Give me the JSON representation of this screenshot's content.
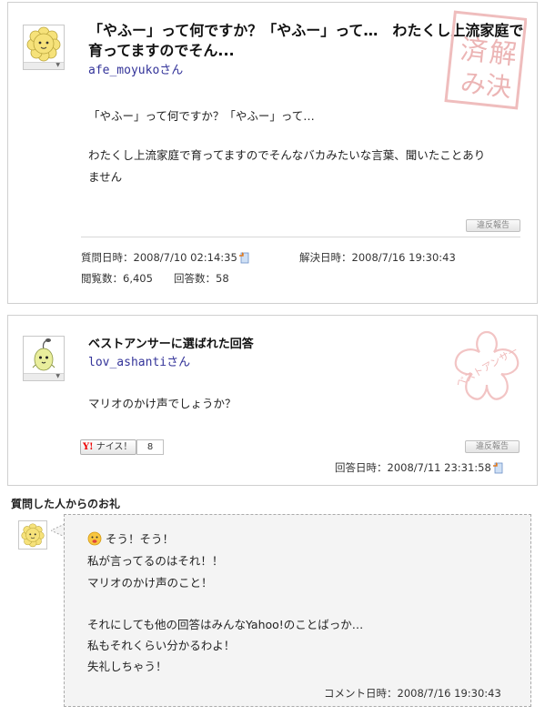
{
  "question": {
    "title": "「やふー」って何ですか？「やふー」って…　わたくし上流家庭で育ってますのでそん...",
    "user_id": "afe_moyuko",
    "honorific": "さん",
    "body_line1": "「やふー」って何ですか？「やふー」って…",
    "body_line2": "わたくし上流家庭で育ってますのでそんなバカみたいな言葉、聞いたことあり",
    "body_line3": "ません",
    "report_label": "違反報告",
    "asked_label": "質問日時：",
    "asked_value": "2008/7/10 02:14:35",
    "resolved_label": "解決日時：",
    "resolved_value": "2008/7/16 19:30:43",
    "views_label": "閲覧数：",
    "views_value": "6,405",
    "answers_label": "回答数：",
    "answers_value": "58",
    "stamp_text_1": "済",
    "stamp_text_2": "解",
    "stamp_text_3": "み決"
  },
  "best_answer": {
    "heading": "ベストアンサーに選ばれた回答",
    "user_id": "lov_ashanti",
    "honorific": "さん",
    "body": "マリオのかけ声でしょうか？",
    "nice_logo": "Y!",
    "nice_label": "ナイス！",
    "nice_count": "8",
    "report_label": "違反報告",
    "answered_label": "回答日時：",
    "answered_value": "2008/7/11 23:31:58",
    "stamp_text": "ベストアンサー"
  },
  "thanks": {
    "heading": "質問した人からのお礼",
    "line1": "そう！そう！",
    "line2": "私が言ってるのはそれ！！",
    "line3": "マリオのかけ声のこと！",
    "line4": "それにしても他の回答はみんなYahoo!のことばっか…",
    "line5": "私もそれくらい分かるわよ！",
    "line6": "失礼しちゃう！",
    "comment_label": "コメント日時：",
    "comment_value": "2008/7/16 19:30:43"
  },
  "colors": {
    "link": "#333399",
    "stamp_red": "#e8a0a0",
    "stamp_pink": "#f2c6c6",
    "border": "#cfcfcf",
    "bubble_bg": "#f4f4f4"
  },
  "icons": {
    "avatar_question": "yellow-flower-avatar",
    "avatar_answer": "green-sprout-avatar",
    "avatar_thanks": "yellow-flower-avatar",
    "clip": "clip-icon",
    "emoji": "happy-face-emoji"
  }
}
